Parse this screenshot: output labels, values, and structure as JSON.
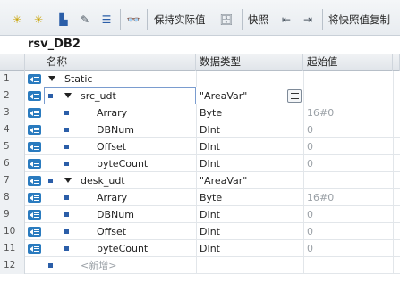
{
  "toolbar": {
    "keep_actual_label": "保持实际值",
    "snapshot_label": "快照",
    "copy_snapshot_label": "将快照值复制"
  },
  "title": "rsv_DB2",
  "columns": [
    "名称",
    "数据类型",
    "起始值"
  ],
  "rows": [
    {
      "num": "1",
      "name": "Static",
      "type": "",
      "start": ""
    },
    {
      "num": "2",
      "name": "src_udt",
      "type": "\"AreaVar\"",
      "start": ""
    },
    {
      "num": "3",
      "name": "Arrary",
      "type": "Byte",
      "start": "16#0"
    },
    {
      "num": "4",
      "name": "DBNum",
      "type": "DInt",
      "start": "0"
    },
    {
      "num": "5",
      "name": "Offset",
      "type": "DInt",
      "start": "0"
    },
    {
      "num": "6",
      "name": "byteCount",
      "type": "DInt",
      "start": "0"
    },
    {
      "num": "7",
      "name": "desk_udt",
      "type": "\"AreaVar\"",
      "start": ""
    },
    {
      "num": "8",
      "name": "Arrary",
      "type": "Byte",
      "start": "16#0"
    },
    {
      "num": "9",
      "name": "DBNum",
      "type": "DInt",
      "start": "0"
    },
    {
      "num": "10",
      "name": "Offset",
      "type": "DInt",
      "start": "0"
    },
    {
      "num": "11",
      "name": "byteCount",
      "type": "DInt",
      "start": "0"
    },
    {
      "num": "12",
      "name": "<新增>",
      "type": "",
      "start": ""
    }
  ]
}
